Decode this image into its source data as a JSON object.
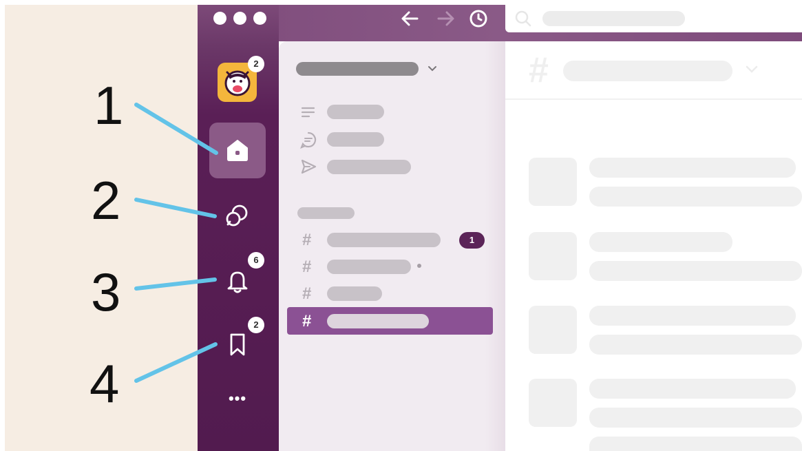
{
  "colors": {
    "rail": "#5a1f56",
    "titlebar": "#7e4b7b",
    "sidebar": "#f1ebf1",
    "selected_channel": "#8b5194",
    "callout_line": "#63c3e8",
    "background_panel": "#f6ede3",
    "workspace_logo": "#f4b63c"
  },
  "titlebar": {
    "window_controls": [
      "dot",
      "dot",
      "dot"
    ],
    "icons": [
      "back-arrow-icon",
      "forward-arrow-icon",
      "history-clock-icon"
    ],
    "search_icon": "search-icon"
  },
  "rail": {
    "workspace_badge": "2",
    "items": [
      {
        "icon": "home-icon",
        "selected": true,
        "badge": ""
      },
      {
        "icon": "dms-chat-icon",
        "badge": ""
      },
      {
        "icon": "bell-icon",
        "badge": "6"
      },
      {
        "icon": "bookmark-icon",
        "badge": "2"
      }
    ],
    "more_label": "•••"
  },
  "sidebar": {
    "channel_symbol": "#",
    "unread_count": "1",
    "quick_icons": [
      "threads-lines-icon",
      "huddle-chat-icon",
      "send-arrow-icon"
    ]
  },
  "main": {
    "channel_symbol": "#"
  },
  "callouts": [
    "1",
    "2",
    "3",
    "4"
  ]
}
